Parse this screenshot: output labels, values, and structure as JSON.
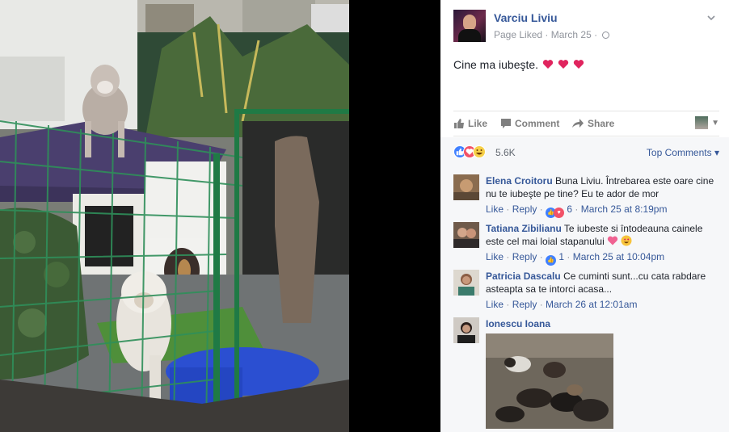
{
  "post": {
    "page_name": "Varciu Liviu",
    "page_liked": "Page Liked",
    "separator": "·",
    "date": "March 25",
    "text": "Cine ma iubeşte.",
    "heart_color": "#e0245e"
  },
  "actions": {
    "like": "Like",
    "comment": "Comment",
    "share": "Share"
  },
  "reactions": {
    "count": "5.6K",
    "types": [
      "like",
      "love",
      "haha"
    ],
    "sort": "Top Comments",
    "sort_caret": "▾"
  },
  "comments": [
    {
      "name": "Elena Croitoru",
      "text": "Buna Liviu. Întrebarea este oare cine nu te iubeşte pe tine? Eu te ador de mor",
      "like_label": "Like",
      "reply_label": "Reply",
      "reaction_count": "6",
      "time": "March 25 at 8:19pm"
    },
    {
      "name": "Tatiana Zibilianu",
      "text": "Te iubeste si întodeauna cainele este cel mai loial stapanului",
      "like_label": "Like",
      "reply_label": "Reply",
      "reaction_count": "1",
      "time": "March 25 at 10:04pm"
    },
    {
      "name": "Patricia Dascalu",
      "text": "Ce cuminti sunt...cu cata rabdare asteapta sa te intorci acasa...",
      "like_label": "Like",
      "reply_label": "Reply",
      "time": "March 26 at 12:01am"
    },
    {
      "name": "Ionescu Ioana"
    }
  ],
  "colors": {
    "link": "#365899",
    "meta": "#90949c",
    "like_blue": "#4080ff",
    "love_red": "#f25268",
    "haha_yellow": "#f7d048"
  }
}
